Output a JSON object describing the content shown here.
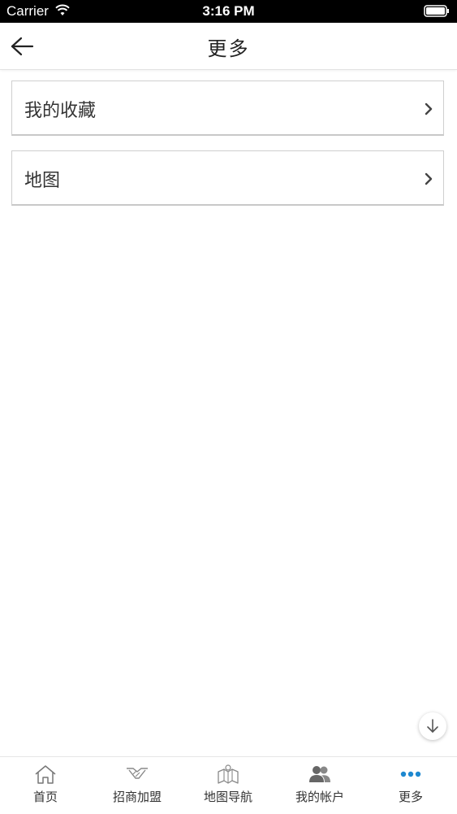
{
  "status_bar": {
    "carrier": "Carrier",
    "time": "3:16 PM"
  },
  "header": {
    "title": "更多"
  },
  "list": {
    "items": [
      {
        "label": "我的收藏"
      },
      {
        "label": "地图"
      }
    ]
  },
  "tabbar": {
    "active_color": "#1e88d0",
    "items": [
      {
        "label": "首页",
        "icon": "home-icon"
      },
      {
        "label": "招商加盟",
        "icon": "handshake-icon"
      },
      {
        "label": "地图导航",
        "icon": "map-icon"
      },
      {
        "label": "我的帐户",
        "icon": "users-icon"
      },
      {
        "label": "更多",
        "icon": "more-dots-icon"
      }
    ]
  }
}
